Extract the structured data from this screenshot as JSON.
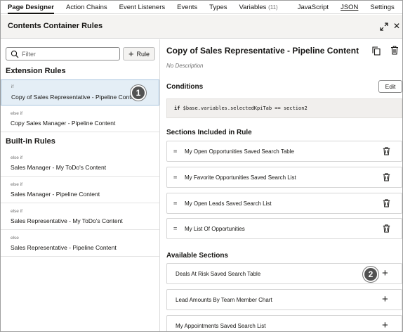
{
  "tabs": [
    {
      "label": "Page Designer",
      "active": true
    },
    {
      "label": "Action Chains"
    },
    {
      "label": "Event Listeners"
    },
    {
      "label": "Events"
    },
    {
      "label": "Types"
    },
    {
      "label": "Variables",
      "count": "(11)"
    },
    {
      "label": "JavaScript"
    },
    {
      "label": "JSON"
    },
    {
      "label": "Settings"
    }
  ],
  "panel": {
    "title": "Contents Container Rules",
    "expand_icon": "expand-icon",
    "close_icon": "close-icon"
  },
  "left": {
    "filter_placeholder": "Filter",
    "rule_button_label": "Rule",
    "extension_heading": "Extension Rules",
    "builtin_heading": "Built-in Rules",
    "extension_rules": [
      {
        "keyword": "if",
        "name": "Copy of Sales Representative - Pipeline Content",
        "selected": true
      },
      {
        "keyword": "else if",
        "name": "Copy Sales Manager - Pipeline Content"
      }
    ],
    "builtin_rules": [
      {
        "keyword": "else if",
        "name": "Sales Manager - My ToDo's Content"
      },
      {
        "keyword": "else if",
        "name": "Sales Manager - Pipeline Content"
      },
      {
        "keyword": "else if",
        "name": "Sales Representative - My ToDo's Content"
      },
      {
        "keyword": "else",
        "name": "Sales Representative - Pipeline Content"
      }
    ]
  },
  "callouts": {
    "one": "1",
    "two": "2"
  },
  "right": {
    "title": "Copy of Sales Representative - Pipeline Content",
    "description": "No Description",
    "conditions_heading": "Conditions",
    "edit_label": "Edit",
    "condition": {
      "keyword": "if",
      "expression": "$base.variables.selectedKpiTab == section2"
    },
    "sections_heading": "Sections Included in Rule",
    "sections": [
      "My Open Opportunities Saved Search Table",
      "My Favorite Opportunities Saved Search List",
      "My Open Leads Saved Search List",
      "My List Of Opportunities"
    ],
    "available_heading": "Available Sections",
    "available": [
      "Deals At Risk Saved Search Table",
      "Lead Amounts By Team Member Chart",
      "My Appointments Saved Search List"
    ],
    "drag_glyph": "=",
    "add_glyph": "+"
  },
  "colors": {
    "selected_bg": "#e4eef6",
    "header_bg": "#f4f3f1",
    "callout": "#525252"
  }
}
